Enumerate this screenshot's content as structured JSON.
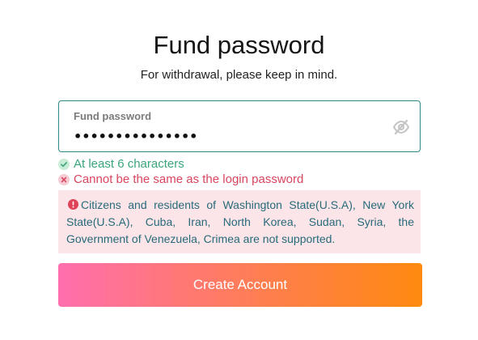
{
  "header": {
    "title": "Fund password",
    "subtitle": "For withdrawal, please keep in mind."
  },
  "fund_password": {
    "label": "Fund password",
    "value": "•••••••••••••••",
    "visibility_toggle_icon": "eye-off-icon"
  },
  "validation": {
    "min_length": {
      "text": "At least 6 characters",
      "status": "passed",
      "color": "#3aa57a",
      "icon": "check-circle-icon"
    },
    "not_login_password": {
      "text": "Cannot be the same as the login password",
      "status": "failed",
      "color": "#d9455f",
      "icon": "x-circle-icon"
    }
  },
  "notice": {
    "icon": "alert-circle-icon",
    "text": "Citizens and residents of Washington State(U.S.A), New York State(U.S.A), Cuba, Iran, North Korea, Sudan, Syria, the Government of Venezuela, Crimea are not supported.",
    "background": "#fbe5e8",
    "text_color": "#276a7a"
  },
  "actions": {
    "create_account_label": "Create Account",
    "gradient_start": "#ff6fae",
    "gradient_end": "#ff8a0f"
  }
}
